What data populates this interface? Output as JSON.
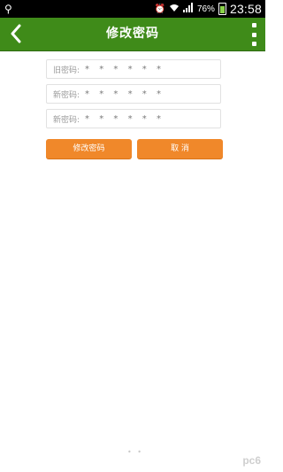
{
  "status_bar": {
    "time": "23:58",
    "battery_percent": "76%"
  },
  "app_bar": {
    "title": "修改密码"
  },
  "form": {
    "old_password": {
      "label": "旧密码:",
      "value": "* * * * * *"
    },
    "new_password": {
      "label": "新密码:",
      "value": "* * * * * *"
    },
    "confirm_password": {
      "label": "新密码:",
      "value": "* * * * * *"
    }
  },
  "buttons": {
    "submit_label": "修改密码",
    "cancel_label": "取 消"
  },
  "footer": {
    "page_dots": "• •",
    "watermark": "pc6"
  },
  "colors": {
    "app_bar": "#3f8b19",
    "button": "#f0882a"
  }
}
